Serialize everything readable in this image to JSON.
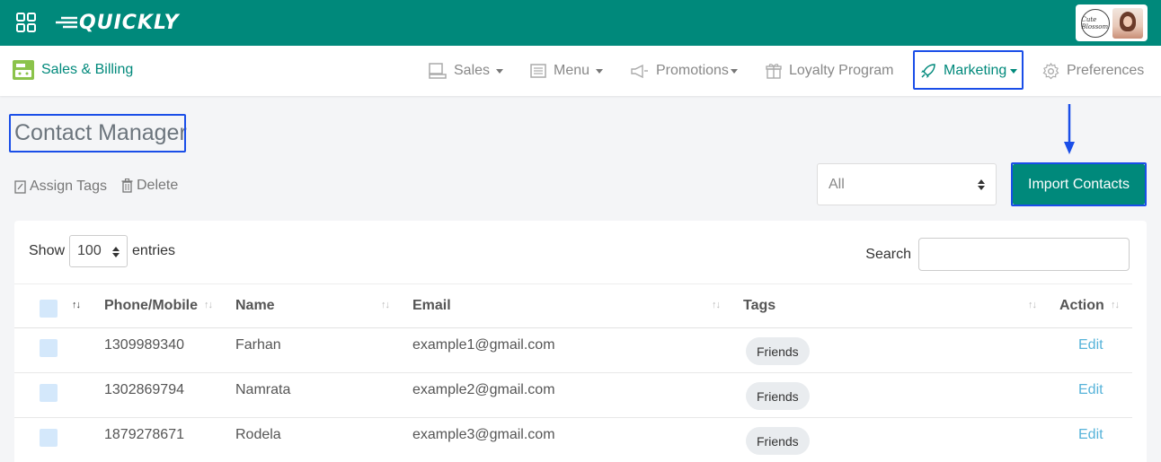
{
  "header": {
    "logo_text": "QUICKLY",
    "brand_badge_text": "Cute Blossom"
  },
  "navbar": {
    "app_name": "Sales & Billing",
    "items": [
      {
        "label": "Sales",
        "icon": "register-icon",
        "dropdown": true
      },
      {
        "label": "Menu",
        "icon": "menu-list-icon",
        "dropdown": true
      },
      {
        "label": "Promotions",
        "icon": "megaphone-icon",
        "dropdown": true
      },
      {
        "label": "Loyalty Program",
        "icon": "gift-icon",
        "dropdown": false
      },
      {
        "label": "Marketing",
        "icon": "rocket-icon",
        "dropdown": true,
        "active": true
      },
      {
        "label": "Preferences",
        "icon": "gear-icon",
        "dropdown": false
      }
    ]
  },
  "page": {
    "title": "Contact Manager",
    "assign_tags_label": "Assign Tags",
    "delete_label": "Delete",
    "filter_value": "All",
    "import_button_label": "Import Contacts"
  },
  "table_controls": {
    "show_label": "Show",
    "entries_value": "100",
    "entries_label": "entries",
    "search_label": "Search",
    "search_value": ""
  },
  "table": {
    "columns": [
      "Phone/Mobile",
      "Name",
      "Email",
      "Tags",
      "Action"
    ],
    "rows": [
      {
        "phone": "1309989340",
        "name": "Farhan",
        "email": "example1@gmail.com",
        "tag": "Friends",
        "action": "Edit"
      },
      {
        "phone": "1302869794",
        "name": "Namrata",
        "email": "example2@gmail.com",
        "tag": "Friends",
        "action": "Edit"
      },
      {
        "phone": "1879278671",
        "name": "Rodela",
        "email": "example3@gmail.com",
        "tag": "Friends",
        "action": "Edit"
      }
    ]
  },
  "colors": {
    "brand": "#00897b",
    "highlight": "#1a4ee8",
    "link": "#56b3d9",
    "checkbox": "#d4e8fb"
  }
}
